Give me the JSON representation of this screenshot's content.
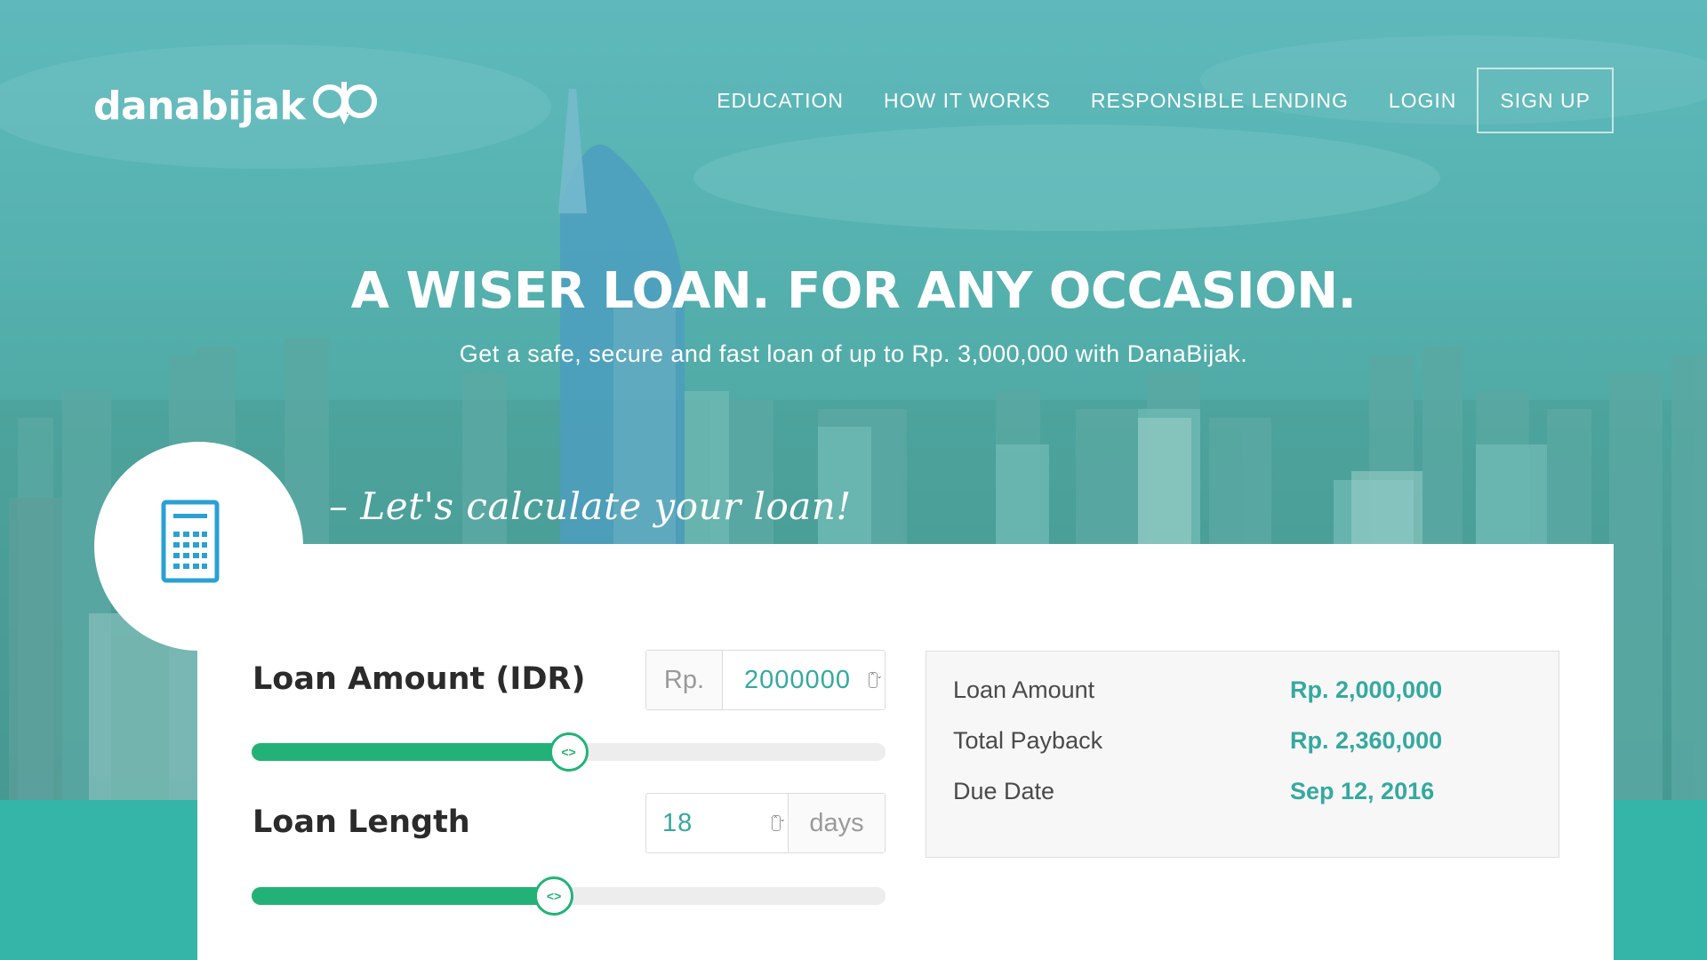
{
  "brand": {
    "name": "danabijak"
  },
  "nav": {
    "items": [
      "EDUCATION",
      "HOW IT WORKS",
      "RESPONSIBLE LENDING",
      "LOGIN"
    ],
    "signup_label": "SIGN UP"
  },
  "hero": {
    "headline": "A WISER LOAN. FOR ANY OCCASION.",
    "subhead": "Get a safe, secure and fast loan of up to Rp. 3,000,000 with DanaBijak."
  },
  "calculator": {
    "title": "– Let's calculate your loan!",
    "icon": "calculator-icon",
    "loan_amount": {
      "label": "Loan Amount (IDR)",
      "prefix": "Rp.",
      "value": "2000000",
      "slider_fraction": 0.5
    },
    "loan_length": {
      "label": "Loan Length",
      "value": "18",
      "suffix": "days",
      "slider_fraction": 0.477
    }
  },
  "summary": {
    "rows": [
      {
        "label": "Loan Amount",
        "value": "Rp. 2,000,000"
      },
      {
        "label": "Total Payback",
        "value": "Rp. 2,360,000"
      },
      {
        "label": "Due Date",
        "value": "Sep 12, 2016"
      }
    ]
  },
  "colors": {
    "accent": "#35a9a0",
    "slider": "#22b278",
    "band": "#35b4a8"
  }
}
